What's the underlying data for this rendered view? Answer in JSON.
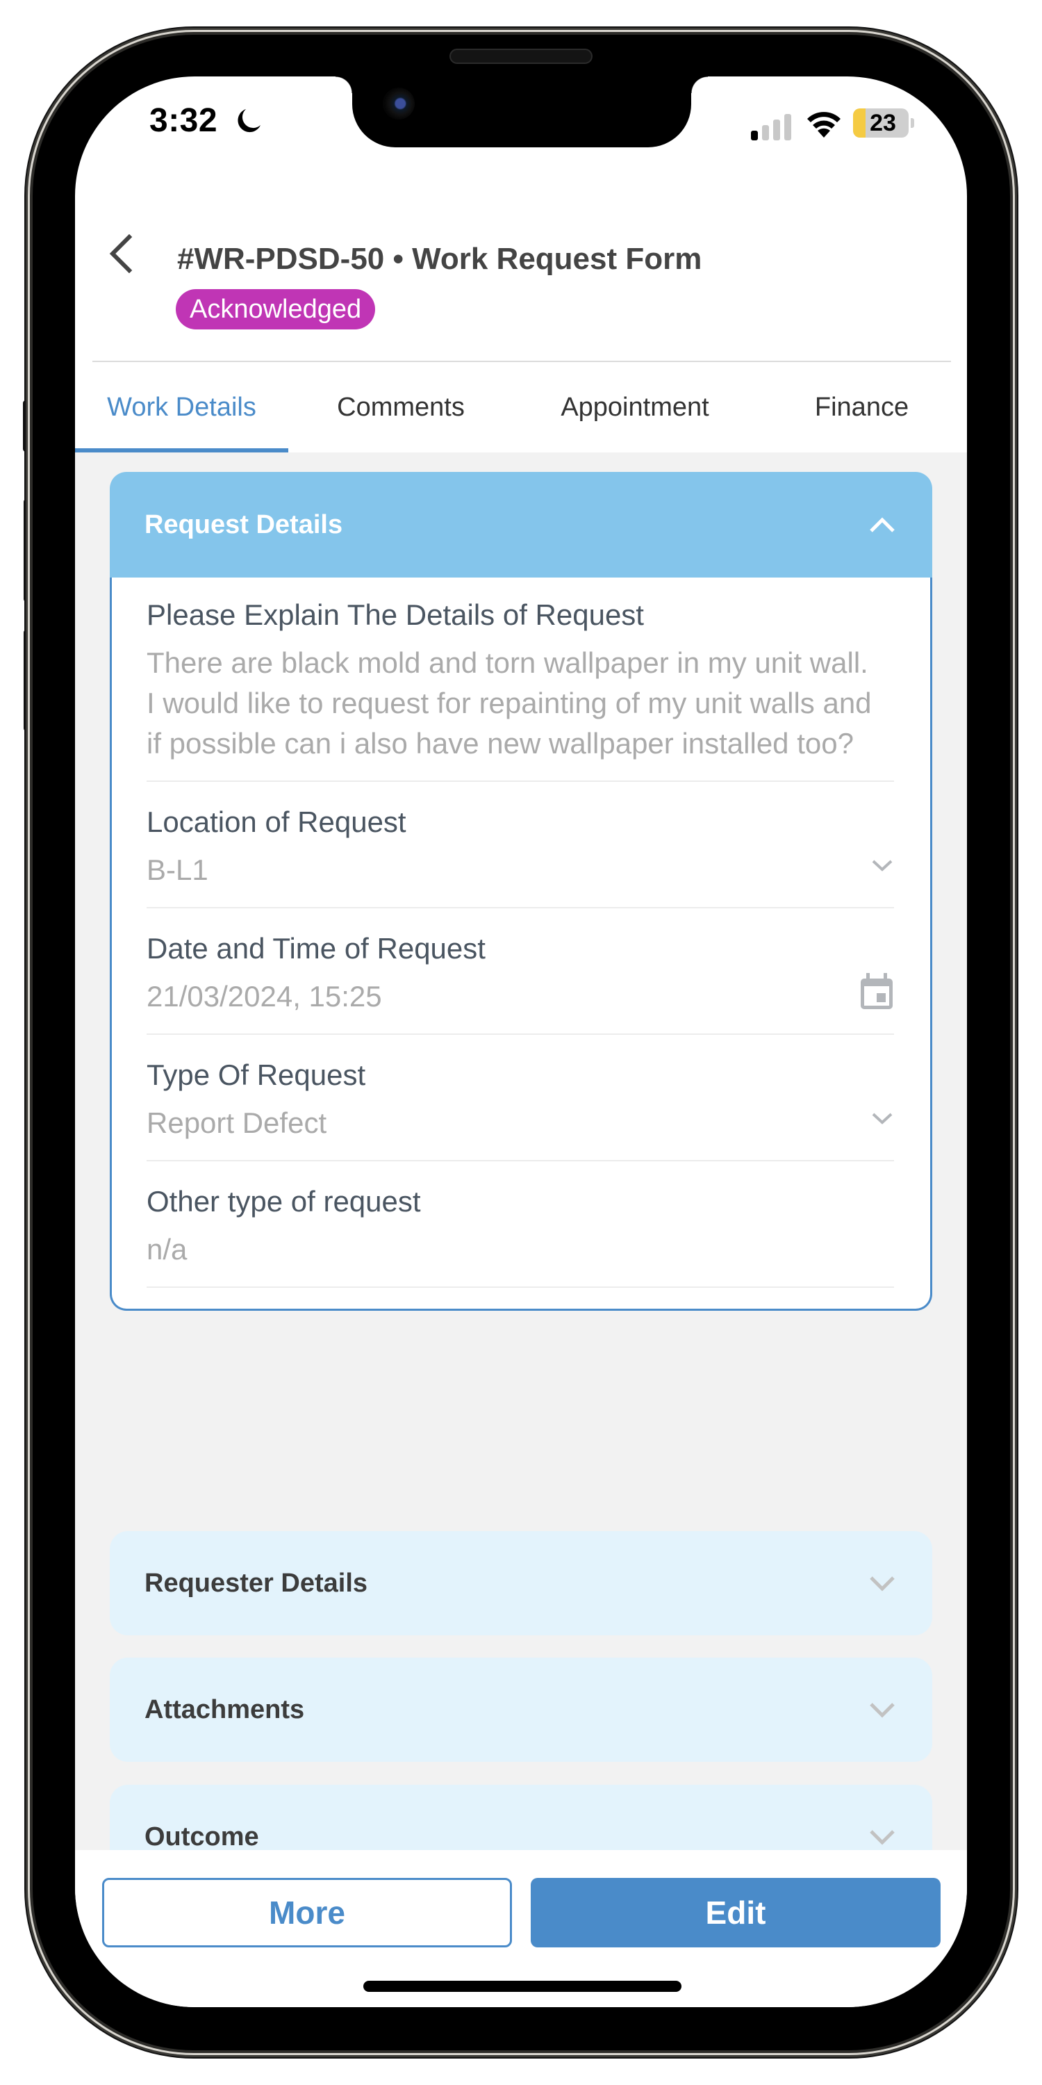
{
  "status_bar": {
    "time": "3:32",
    "focus_icon": "moon-icon",
    "signal_bars_active": 1,
    "signal_bars_total": 4,
    "battery_percent": 23,
    "battery_label": "23",
    "colors": {
      "battery_fill": "#f5cb43"
    }
  },
  "header": {
    "back_icon": "chevron-left-icon",
    "title": "#WR-PDSD-50 • Work Request Form",
    "status_badge": "Acknowledged",
    "colors": {
      "badge": "#c035b5",
      "title": "#444444"
    }
  },
  "tabs": [
    {
      "label": "Work Details",
      "active": true
    },
    {
      "label": "Comments",
      "active": false
    },
    {
      "label": "Appointment",
      "active": false
    },
    {
      "label": "Finance",
      "active": false
    }
  ],
  "sections": {
    "request_details": {
      "title": "Request Details",
      "expanded": true,
      "toggle_icon": "chevron-up-icon",
      "fields": [
        {
          "label": "Please Explain The Details of Request",
          "value": "There are black mold and torn wallpaper in my unit wall.\nI would like to request for repainting of my unit walls and if possible can i also have new wallpaper installed too?",
          "type": "textarea"
        },
        {
          "label": "Location of Request",
          "value": "B-L1",
          "type": "select",
          "icon": "chevron-down-icon"
        },
        {
          "label": "Date and Time of Request",
          "value": "21/03/2024, 15:25",
          "type": "datetime",
          "icon": "calendar-icon"
        },
        {
          "label": "Type Of Request",
          "value": "Report Defect",
          "type": "select",
          "icon": "chevron-down-icon"
        },
        {
          "label": "Other type of request",
          "value": "n/a",
          "type": "text"
        }
      ]
    },
    "collapsed": [
      {
        "title": "Requester Details",
        "expanded": false,
        "toggle_icon": "chevron-down-icon"
      },
      {
        "title": "Attachments",
        "expanded": false,
        "toggle_icon": "chevron-down-icon"
      },
      {
        "title": "Outcome",
        "expanded": false,
        "toggle_icon": "chevron-down-icon"
      }
    ]
  },
  "actions": {
    "more_label": "More",
    "edit_label": "Edit"
  },
  "colors": {
    "primary": "#4a8bc9",
    "section_header_open": "#84c5eb",
    "section_header_collapsed": "#e3f3fc",
    "page_background": "#f2f2f2",
    "label_text": "#4a5561",
    "value_text": "#aaaaaa"
  }
}
